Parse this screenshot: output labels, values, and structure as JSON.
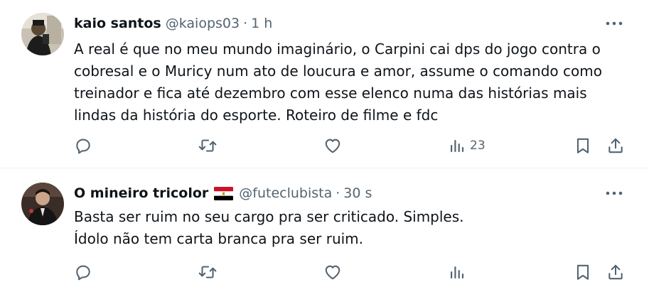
{
  "tweets": [
    {
      "display_name": "kaio santos",
      "handle": "@kaiops03",
      "separator": "·",
      "time": "1 h",
      "flag": "",
      "text_lines": [
        "A real é que no meu mundo imaginário, o Carpini cai dps do jogo contra o",
        "cobresal e o Muricy num ato de loucura e amor, assume o comando como",
        "treinador e fica até dezembro com esse elenco numa das histórias mais",
        "lindas da história do esporte. Roteiro de filme e fdc"
      ],
      "views": "23",
      "icons": {
        "reply": "reply-icon",
        "retweet": "retweet-icon",
        "like": "heart-icon",
        "views": "views-icon",
        "bookmark": "bookmark-icon",
        "share": "share-icon",
        "more": "more-icon"
      }
    },
    {
      "display_name": "O mineiro tricolor",
      "handle": "@futeclubista",
      "separator": "·",
      "time": "30 s",
      "flag": "egypt-flag",
      "text_lines": [
        "Basta ser ruim no seu cargo pra ser criticado. Simples.",
        "Ídolo não tem carta branca pra ser ruim."
      ],
      "views": "",
      "icons": {
        "reply": "reply-icon",
        "retweet": "retweet-icon",
        "like": "heart-icon",
        "views": "views-icon",
        "bookmark": "bookmark-icon",
        "share": "share-icon",
        "more": "more-icon"
      }
    }
  ],
  "colors": {
    "text_primary": "#0f1419",
    "text_secondary": "#536471",
    "divider": "#eff3f4",
    "flag_red": "#ce1126",
    "flag_white": "#ffffff",
    "flag_black": "#000000"
  }
}
